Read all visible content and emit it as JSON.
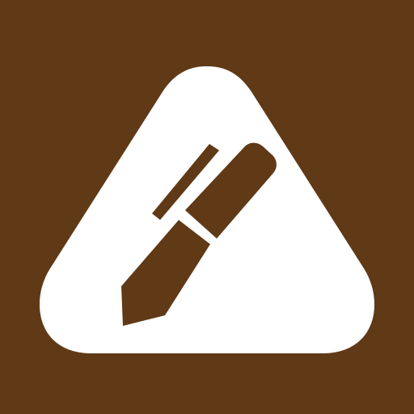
{
  "icon": {
    "name": "pen-in-rounded-triangle-icon",
    "colors": {
      "background": "#603916",
      "triangle": "#ffffff",
      "pen": "#603916"
    }
  }
}
